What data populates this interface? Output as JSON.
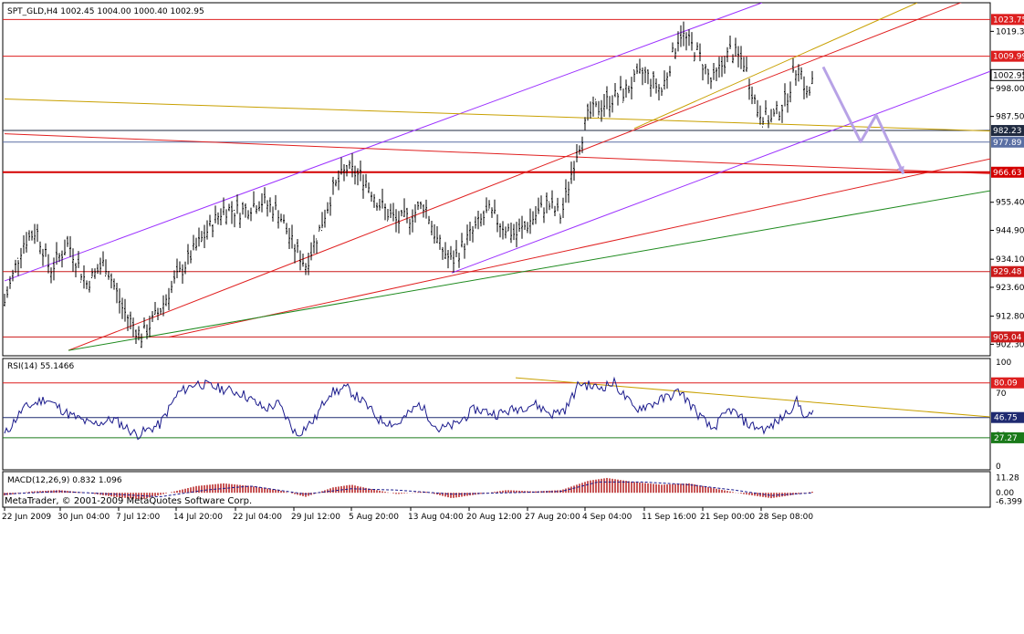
{
  "main": {
    "header": "SPT_GLD,H4  1002.45 1004.00 1000.40 1002.95",
    "ticks": [
      "1019.30",
      "998.00",
      "987.50",
      "955.40",
      "944.90",
      "934.10",
      "923.60",
      "912.80",
      "902.30"
    ],
    "hlines": [
      {
        "label": "1023.75",
        "color": "#dd1f1f",
        "hl": true
      },
      {
        "label": "1009.99",
        "color": "#dd1f1f",
        "hl": true
      },
      {
        "label": "1002.95",
        "color": "#000000",
        "hl": true,
        "cur": true
      },
      {
        "label": "982.23",
        "color": "#1f2a40",
        "hl": true
      },
      {
        "label": "977.89",
        "color": "#5a6fa3",
        "hl": true
      },
      {
        "label": "966.63",
        "color": "#d40000",
        "hl": true
      },
      {
        "label": "929.48",
        "color": "#cc1a1a",
        "hl": true
      },
      {
        "label": "905.04",
        "color": "#cc1a1a",
        "hl": true
      }
    ]
  },
  "rsi": {
    "header": "RSI(14) 55.1466",
    "ticks": [
      "100",
      "70",
      "30",
      "0"
    ],
    "levels": [
      {
        "label": "80.09",
        "color": "#dd1f1f"
      },
      {
        "label": "46.75",
        "color": "#1f2a70"
      },
      {
        "label": "27.27",
        "color": "#1a7a1a"
      }
    ]
  },
  "macd": {
    "header": "MACD(12,26,9) 0.832 1.096",
    "ticks": [
      "11.28",
      "0.00",
      "-6.399"
    ]
  },
  "copyright": "MetaTrader, © 2001-2009 MetaQuotes Software Corp.",
  "time_axis": [
    "22 Jun 2009",
    "30 Jun 04:00",
    "7 Jul 12:00",
    "14 Jul 20:00",
    "22 Jul 04:00",
    "29 Jul 12:00",
    "5 Aug 20:00",
    "13 Aug 04:00",
    "20 Aug 12:00",
    "27 Aug 20:00",
    "4 Sep 04:00",
    "11 Sep 16:00",
    "21 Sep 00:00",
    "28 Sep 08:00"
  ],
  "colors": {
    "bull": "#000000",
    "purple": "#9b30ff",
    "red": "#e02020",
    "orange": "#c8a000",
    "green": "#1e8a1e",
    "arrow": "#b7a2e6",
    "macd_hist": "#b51f1f"
  },
  "chart_data": {
    "type": "line",
    "title": "SPT_GLD,H4",
    "ohlc_last": {
      "open": 1002.45,
      "high": 1004.0,
      "low": 1000.4,
      "close": 1002.95
    },
    "ylim": [
      898.0,
      1030.0
    ],
    "path_points": [
      {
        "t": 0,
        "v": 918
      },
      {
        "t": 20,
        "v": 940
      },
      {
        "t": 35,
        "v": 945
      },
      {
        "t": 50,
        "v": 930
      },
      {
        "t": 70,
        "v": 940
      },
      {
        "t": 90,
        "v": 925
      },
      {
        "t": 110,
        "v": 933
      },
      {
        "t": 130,
        "v": 915
      },
      {
        "t": 150,
        "v": 905
      },
      {
        "t": 170,
        "v": 915
      },
      {
        "t": 185,
        "v": 925
      },
      {
        "t": 205,
        "v": 936
      },
      {
        "t": 225,
        "v": 946
      },
      {
        "t": 240,
        "v": 953
      },
      {
        "t": 260,
        "v": 952
      },
      {
        "t": 280,
        "v": 956
      },
      {
        "t": 300,
        "v": 952
      },
      {
        "t": 315,
        "v": 940
      },
      {
        "t": 330,
        "v": 932
      },
      {
        "t": 345,
        "v": 945
      },
      {
        "t": 360,
        "v": 960
      },
      {
        "t": 375,
        "v": 968
      },
      {
        "t": 395,
        "v": 964
      },
      {
        "t": 410,
        "v": 955
      },
      {
        "t": 430,
        "v": 948
      },
      {
        "t": 445,
        "v": 950
      },
      {
        "t": 460,
        "v": 955
      },
      {
        "t": 475,
        "v": 940
      },
      {
        "t": 490,
        "v": 933
      },
      {
        "t": 510,
        "v": 943
      },
      {
        "t": 530,
        "v": 952
      },
      {
        "t": 545,
        "v": 947
      },
      {
        "t": 560,
        "v": 943
      },
      {
        "t": 575,
        "v": 948
      },
      {
        "t": 595,
        "v": 955
      },
      {
        "t": 610,
        "v": 950
      },
      {
        "t": 625,
        "v": 972
      },
      {
        "t": 640,
        "v": 988
      },
      {
        "t": 660,
        "v": 993
      },
      {
        "t": 680,
        "v": 997
      },
      {
        "t": 700,
        "v": 1004
      },
      {
        "t": 720,
        "v": 997
      },
      {
        "t": 740,
        "v": 1019
      },
      {
        "t": 760,
        "v": 1011
      },
      {
        "t": 775,
        "v": 1000
      },
      {
        "t": 795,
        "v": 1012
      },
      {
        "t": 810,
        "v": 1008
      },
      {
        "t": 825,
        "v": 990
      },
      {
        "t": 840,
        "v": 986
      },
      {
        "t": 855,
        "v": 993
      },
      {
        "t": 870,
        "v": 1008
      },
      {
        "t": 880,
        "v": 994
      },
      {
        "t": 887,
        "v": 1003
      }
    ],
    "projection": [
      {
        "t": 897,
        "v": 1006
      },
      {
        "t": 938,
        "v": 978
      },
      {
        "t": 955,
        "v": 988
      },
      {
        "t": 985,
        "v": 966
      }
    ],
    "trendlines": [
      {
        "color": "purple",
        "from": {
          "t": 0,
          "v": 926
        },
        "to": {
          "t": 830,
          "v": 1030
        }
      },
      {
        "color": "purple",
        "from": {
          "t": 490,
          "v": 929
        },
        "to": {
          "t": 1085,
          "v": 1005
        }
      },
      {
        "color": "red",
        "from": {
          "t": 0,
          "v": 981
        },
        "to": {
          "t": 1085,
          "v": 966
        }
      },
      {
        "color": "red",
        "from": {
          "t": 70,
          "v": 900
        },
        "to": {
          "t": 1055,
          "v": 1031
        }
      },
      {
        "color": "red",
        "from": {
          "t": 180,
          "v": 905
        },
        "to": {
          "t": 1085,
          "v": 972
        }
      },
      {
        "color": "orange",
        "from": {
          "t": 0,
          "v": 994
        },
        "to": {
          "t": 1085,
          "v": 982
        }
      },
      {
        "color": "orange",
        "from": {
          "t": 690,
          "v": 983
        },
        "to": {
          "t": 1000,
          "v": 1030
        }
      },
      {
        "color": "green",
        "from": {
          "t": 70,
          "v": 900
        },
        "to": {
          "t": 1085,
          "v": 960
        }
      }
    ],
    "rsi_series": [
      {
        "t": 0,
        "v": 30
      },
      {
        "t": 20,
        "v": 55
      },
      {
        "t": 45,
        "v": 65
      },
      {
        "t": 70,
        "v": 50
      },
      {
        "t": 95,
        "v": 40
      },
      {
        "t": 120,
        "v": 45
      },
      {
        "t": 145,
        "v": 30
      },
      {
        "t": 170,
        "v": 40
      },
      {
        "t": 190,
        "v": 70
      },
      {
        "t": 210,
        "v": 80
      },
      {
        "t": 235,
        "v": 75
      },
      {
        "t": 260,
        "v": 70
      },
      {
        "t": 285,
        "v": 55
      },
      {
        "t": 300,
        "v": 60
      },
      {
        "t": 320,
        "v": 30
      },
      {
        "t": 340,
        "v": 45
      },
      {
        "t": 355,
        "v": 70
      },
      {
        "t": 375,
        "v": 75
      },
      {
        "t": 395,
        "v": 60
      },
      {
        "t": 410,
        "v": 45
      },
      {
        "t": 430,
        "v": 40
      },
      {
        "t": 455,
        "v": 60
      },
      {
        "t": 475,
        "v": 35
      },
      {
        "t": 495,
        "v": 40
      },
      {
        "t": 515,
        "v": 55
      },
      {
        "t": 540,
        "v": 50
      },
      {
        "t": 560,
        "v": 55
      },
      {
        "t": 580,
        "v": 60
      },
      {
        "t": 600,
        "v": 50
      },
      {
        "t": 615,
        "v": 55
      },
      {
        "t": 630,
        "v": 80
      },
      {
        "t": 650,
        "v": 75
      },
      {
        "t": 668,
        "v": 80
      },
      {
        "t": 690,
        "v": 55
      },
      {
        "t": 710,
        "v": 60
      },
      {
        "t": 740,
        "v": 72
      },
      {
        "t": 760,
        "v": 50
      },
      {
        "t": 775,
        "v": 35
      },
      {
        "t": 795,
        "v": 55
      },
      {
        "t": 815,
        "v": 40
      },
      {
        "t": 835,
        "v": 35
      },
      {
        "t": 850,
        "v": 45
      },
      {
        "t": 868,
        "v": 62
      },
      {
        "t": 880,
        "v": 45
      },
      {
        "t": 887,
        "v": 55
      }
    ],
    "rsi_lines": [
      {
        "color": "orange",
        "from": {
          "t": 560,
          "v": 85
        },
        "to": {
          "t": 1085,
          "v": 47
        }
      }
    ],
    "macd_series": [
      {
        "t": 0,
        "v": -2
      },
      {
        "t": 30,
        "v": 1
      },
      {
        "t": 60,
        "v": 2
      },
      {
        "t": 90,
        "v": 0
      },
      {
        "t": 120,
        "v": -3
      },
      {
        "t": 150,
        "v": -5
      },
      {
        "t": 180,
        "v": 0
      },
      {
        "t": 210,
        "v": 5
      },
      {
        "t": 240,
        "v": 7
      },
      {
        "t": 270,
        "v": 5
      },
      {
        "t": 300,
        "v": 2
      },
      {
        "t": 330,
        "v": -3
      },
      {
        "t": 360,
        "v": 4
      },
      {
        "t": 380,
        "v": 6
      },
      {
        "t": 400,
        "v": 3
      },
      {
        "t": 430,
        "v": -1
      },
      {
        "t": 460,
        "v": 1
      },
      {
        "t": 490,
        "v": -4
      },
      {
        "t": 520,
        "v": -1
      },
      {
        "t": 550,
        "v": 2
      },
      {
        "t": 580,
        "v": 1
      },
      {
        "t": 610,
        "v": 2
      },
      {
        "t": 640,
        "v": 9
      },
      {
        "t": 660,
        "v": 11
      },
      {
        "t": 690,
        "v": 8
      },
      {
        "t": 720,
        "v": 6
      },
      {
        "t": 750,
        "v": 7
      },
      {
        "t": 780,
        "v": 3
      },
      {
        "t": 810,
        "v": -1
      },
      {
        "t": 840,
        "v": -4
      },
      {
        "t": 860,
        "v": -2
      },
      {
        "t": 887,
        "v": 1
      }
    ],
    "macd_signal": [
      {
        "t": 0,
        "v": -1
      },
      {
        "t": 60,
        "v": 1
      },
      {
        "t": 120,
        "v": -1
      },
      {
        "t": 170,
        "v": -3
      },
      {
        "t": 220,
        "v": 2
      },
      {
        "t": 270,
        "v": 5
      },
      {
        "t": 330,
        "v": -1
      },
      {
        "t": 380,
        "v": 3
      },
      {
        "t": 430,
        "v": 2
      },
      {
        "t": 490,
        "v": -1
      },
      {
        "t": 550,
        "v": 0
      },
      {
        "t": 610,
        "v": 1
      },
      {
        "t": 650,
        "v": 8
      },
      {
        "t": 700,
        "v": 8
      },
      {
        "t": 750,
        "v": 6
      },
      {
        "t": 800,
        "v": 2
      },
      {
        "t": 840,
        "v": -2
      },
      {
        "t": 887,
        "v": 0
      }
    ]
  }
}
